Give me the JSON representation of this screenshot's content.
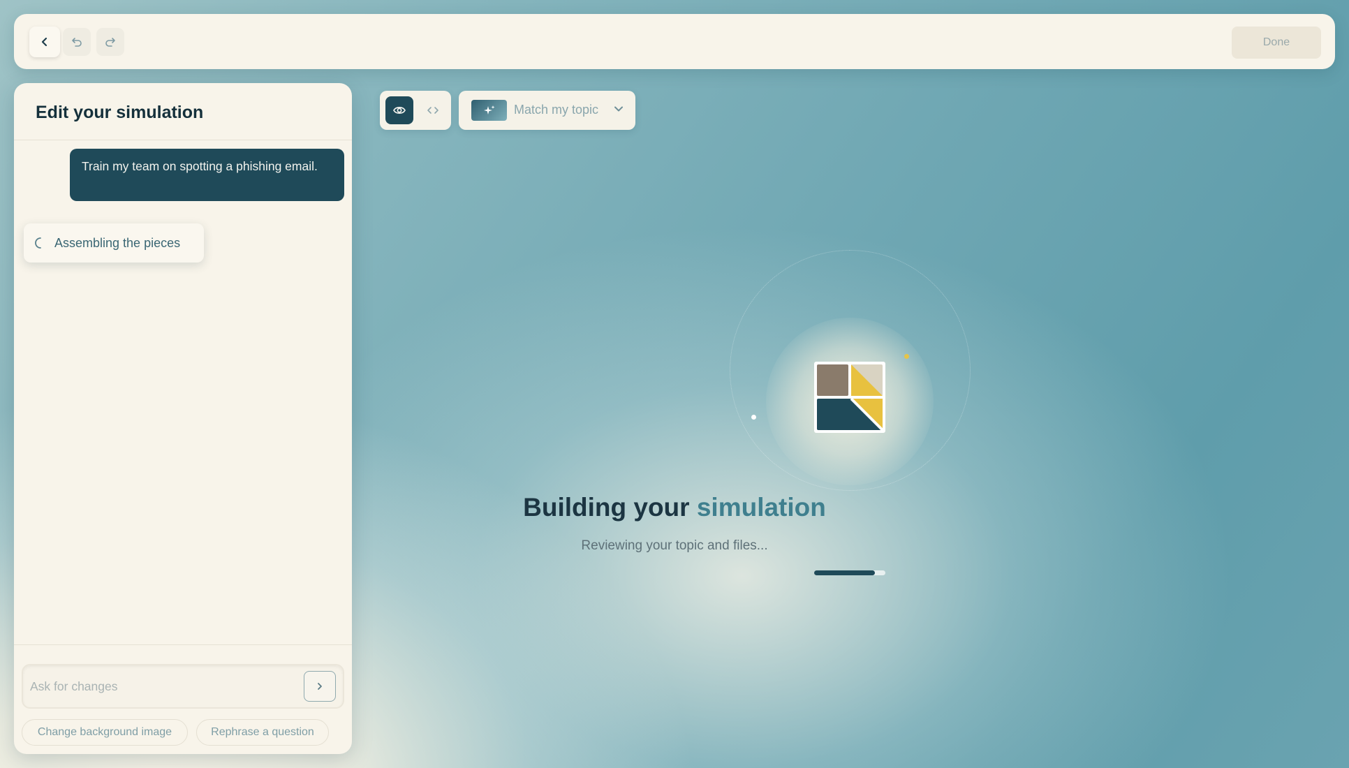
{
  "topbar": {
    "back_icon": "chevron-left-icon",
    "undo_icon": "undo-icon",
    "redo_icon": "redo-icon",
    "done_label": "Done"
  },
  "panel": {
    "title": "Edit your simulation",
    "messages": [
      {
        "role": "user",
        "text": "Train my team on spotting a phishing email."
      }
    ],
    "status": {
      "icon": "spinner-icon",
      "text": "Assembling the pieces"
    },
    "input": {
      "placeholder": "Ask for changes",
      "value": "",
      "send_icon": "chevron-right-icon"
    },
    "suggestions": [
      "Change background image",
      "Rephrase a question"
    ]
  },
  "toolbar": {
    "view_modes": [
      {
        "icon": "eye-icon",
        "active": true
      },
      {
        "icon": "code-icon",
        "active": false
      }
    ],
    "theme": {
      "icon": "sparkle-icon",
      "label": "Match my topic",
      "chevron": "chevron-down-icon"
    }
  },
  "building": {
    "title_part1": "Building your",
    "title_part2": "simulation",
    "subtitle": "Reviewing your topic and files...",
    "progress": 0.85
  },
  "colors": {
    "accent_dark": "#1f4a59",
    "accent_teal": "#3f7f8e",
    "logo_brown": "#8a7b6b",
    "logo_yellow": "#e8c13f",
    "logo_beige": "#d9d3c2"
  }
}
